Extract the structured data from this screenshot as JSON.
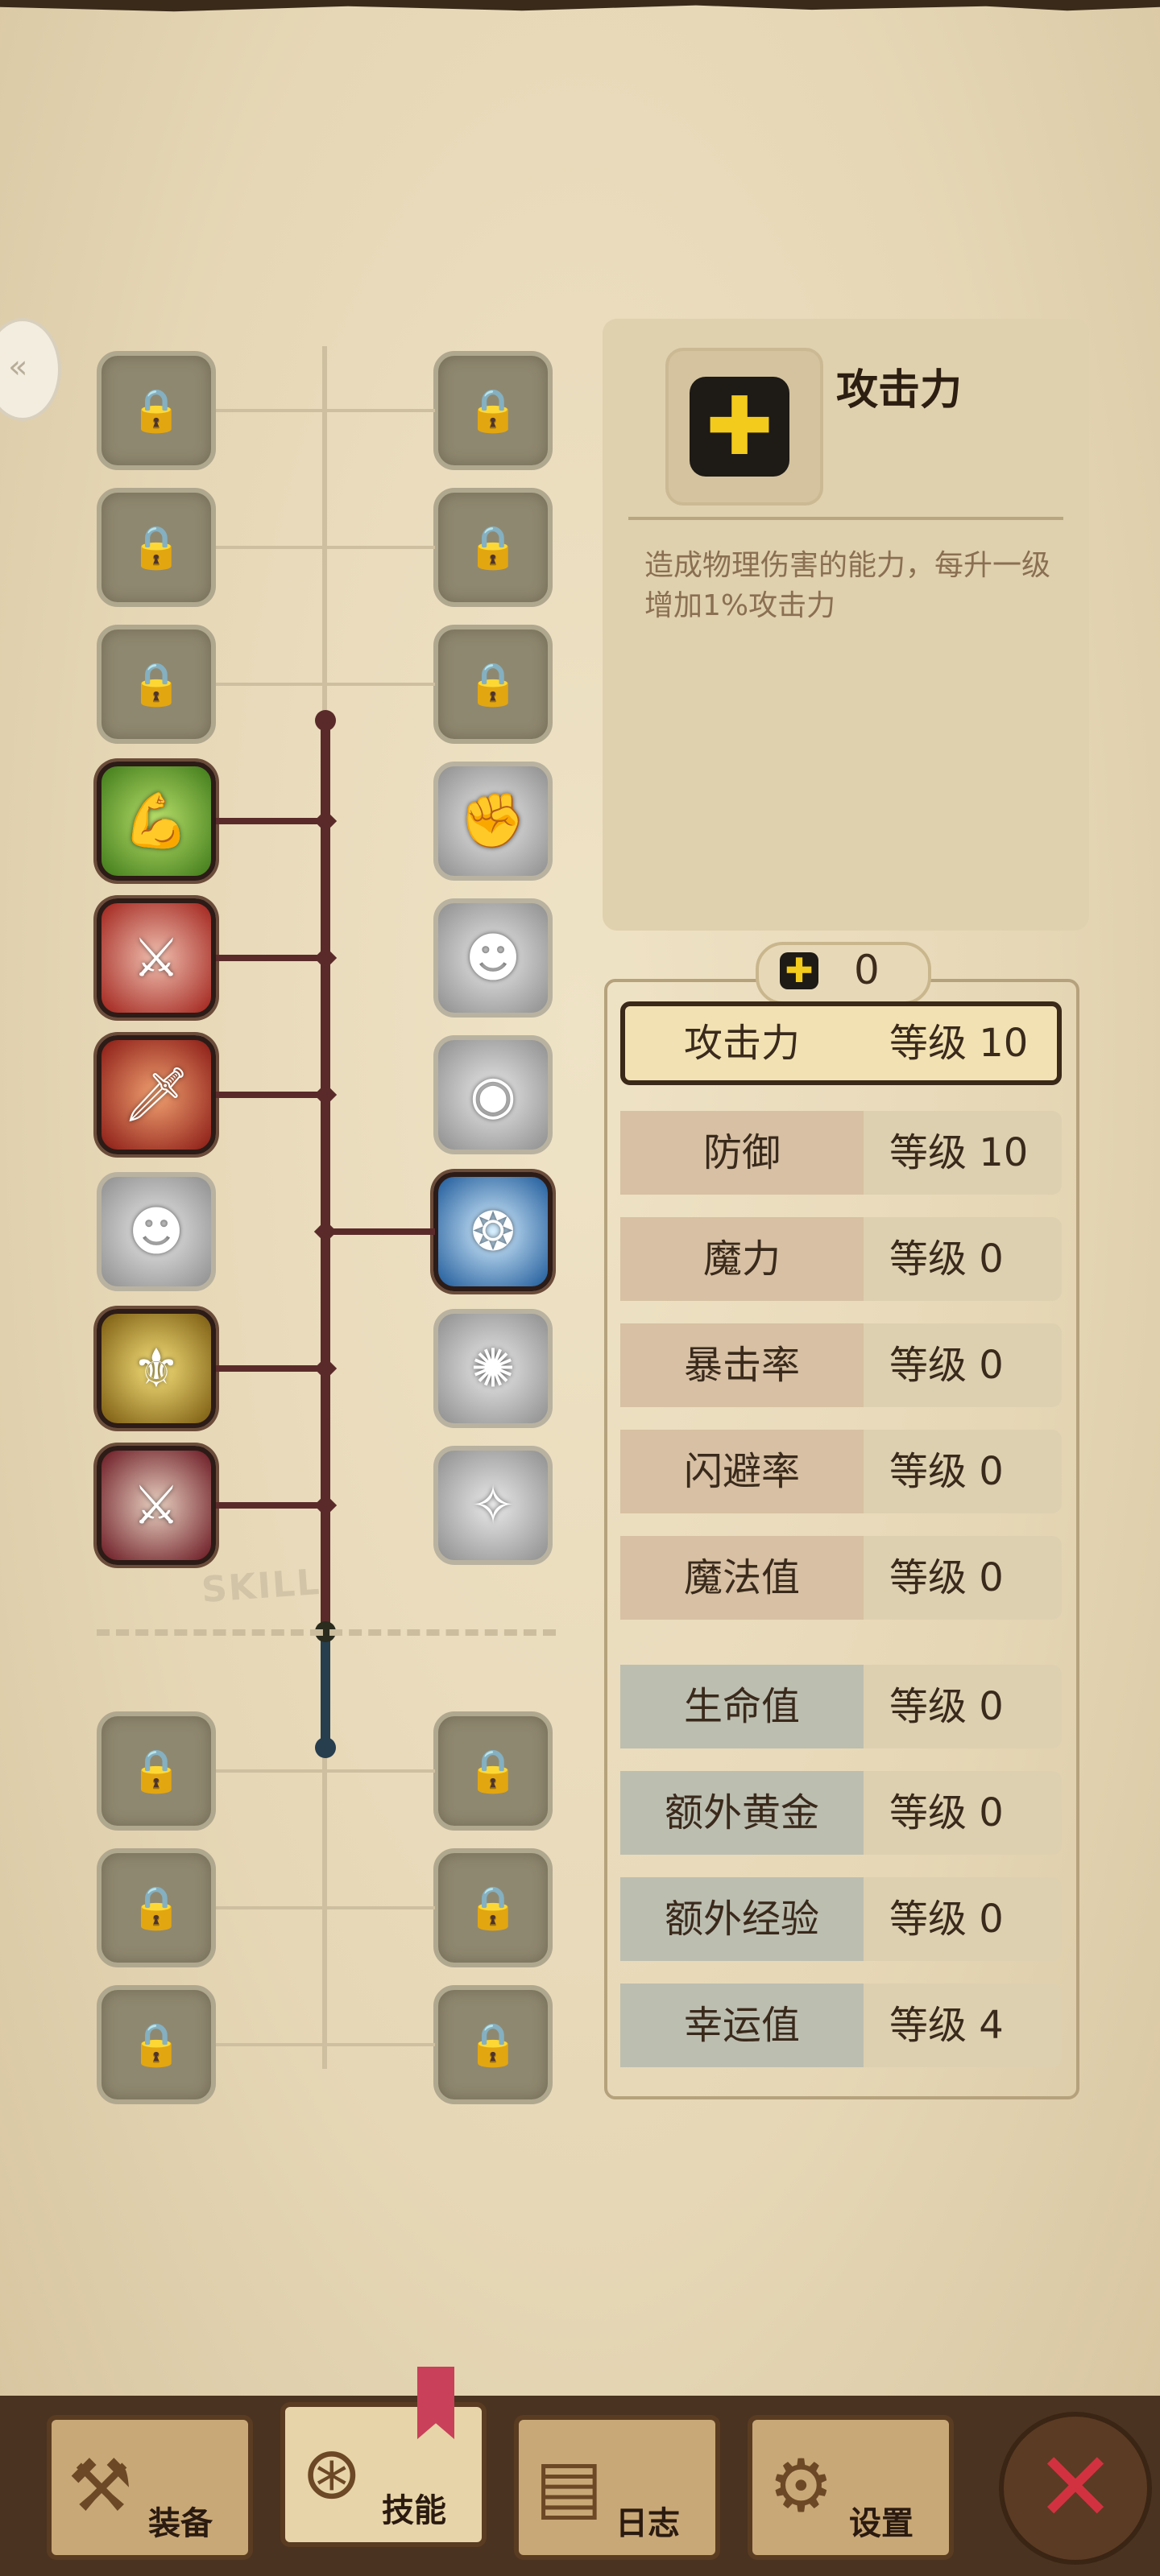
{
  "colors": {
    "accent": "#f3cb1c",
    "tree_line": "#5a2a2a",
    "selected_border": "#3a2818"
  },
  "tree": {
    "skill_label": "SKILL",
    "left_column": [
      {
        "state": "locked",
        "icon": "lock-icon"
      },
      {
        "state": "locked",
        "icon": "lock-icon"
      },
      {
        "state": "locked",
        "icon": "lock-icon"
      },
      {
        "state": "active",
        "icon": "muscle-arm-icon"
      },
      {
        "state": "active",
        "icon": "slash-icon"
      },
      {
        "state": "active",
        "icon": "dagger-icon"
      },
      {
        "state": "inactive",
        "icon": "dash-figure-icon"
      },
      {
        "state": "active",
        "icon": "golden-armor-icon"
      },
      {
        "state": "active",
        "icon": "crossed-swords-icon"
      },
      {
        "state": "locked",
        "icon": "lock-icon"
      },
      {
        "state": "locked",
        "icon": "lock-icon"
      },
      {
        "state": "locked",
        "icon": "lock-icon"
      }
    ],
    "right_column": [
      {
        "state": "locked",
        "icon": "lock-icon"
      },
      {
        "state": "locked",
        "icon": "lock-icon"
      },
      {
        "state": "locked",
        "icon": "lock-icon"
      },
      {
        "state": "inactive",
        "icon": "fist-icon"
      },
      {
        "state": "inactive",
        "icon": "fighter-icon"
      },
      {
        "state": "inactive",
        "icon": "eye-burst-icon"
      },
      {
        "state": "active",
        "icon": "whirlwind-blade-icon"
      },
      {
        "state": "inactive",
        "icon": "gear-burst-icon"
      },
      {
        "state": "inactive",
        "icon": "sparkle-figure-icon"
      },
      {
        "state": "locked",
        "icon": "lock-icon"
      },
      {
        "state": "locked",
        "icon": "lock-icon"
      },
      {
        "state": "locked",
        "icon": "lock-icon"
      }
    ]
  },
  "info": {
    "icon": "plus-icon",
    "title": "攻击力",
    "description": "造成物理伤害的能力，每升一级增加1%攻击力"
  },
  "points": {
    "icon": "plus-icon",
    "value": "0"
  },
  "stats": [
    {
      "name": "攻击力",
      "level": "等级 10",
      "group": "brown",
      "selected": true
    },
    {
      "name": "防御",
      "level": "等级 10",
      "group": "brown",
      "selected": false
    },
    {
      "name": "魔力",
      "level": "等级 0",
      "group": "brown",
      "selected": false
    },
    {
      "name": "暴击率",
      "level": "等级 0",
      "group": "brown",
      "selected": false
    },
    {
      "name": "闪避率",
      "level": "等级 0",
      "group": "brown",
      "selected": false
    },
    {
      "name": "魔法值",
      "level": "等级 0",
      "group": "brown",
      "selected": false
    },
    {
      "name": "生命值",
      "level": "等级 0",
      "group": "blue",
      "selected": false
    },
    {
      "name": "额外黄金",
      "level": "等级 0",
      "group": "blue",
      "selected": false
    },
    {
      "name": "额外经验",
      "level": "等级 0",
      "group": "blue",
      "selected": false
    },
    {
      "name": "幸运值",
      "level": "等级 4",
      "group": "blue",
      "selected": false
    }
  ],
  "nav": {
    "tabs": [
      {
        "label": "装备",
        "icon": "axe-icon",
        "active": false
      },
      {
        "label": "技能",
        "icon": "skill-gear-icon",
        "active": true
      },
      {
        "label": "日志",
        "icon": "scroll-icon",
        "active": false
      },
      {
        "label": "设置",
        "icon": "settings-gear-icon",
        "active": false
      }
    ],
    "close_icon": "close-icon"
  }
}
